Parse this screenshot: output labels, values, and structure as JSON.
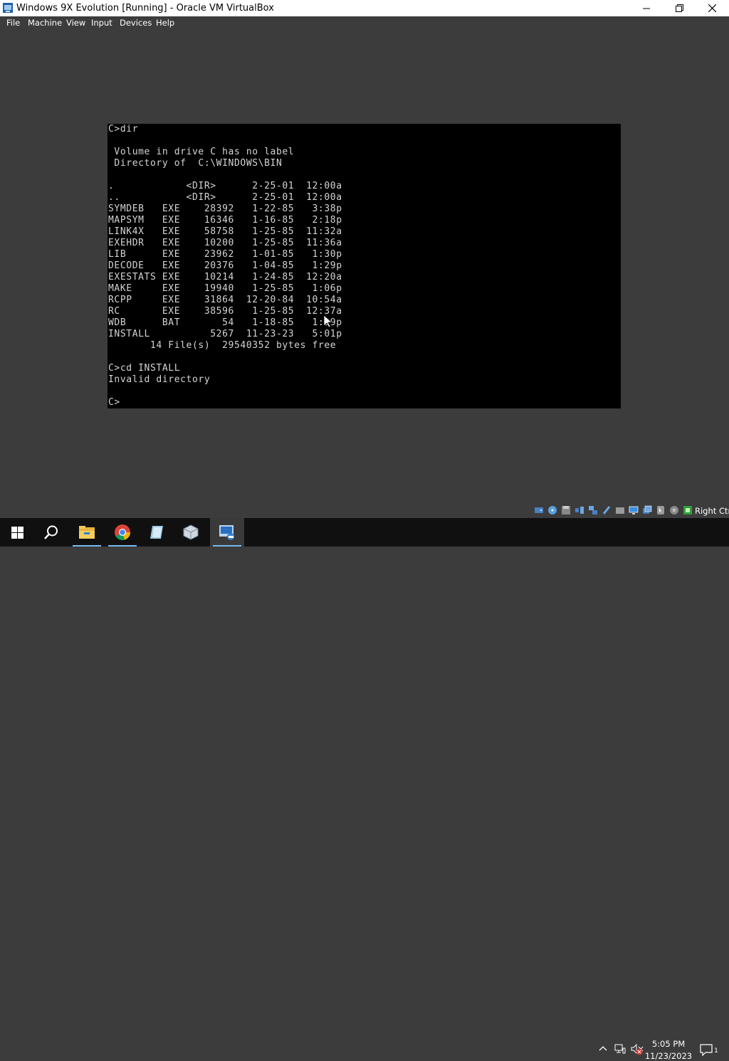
{
  "window": {
    "title": "Windows 9X Evolution [Running] - Oracle VM VirtualBox",
    "minimize_icon": "minimize-icon",
    "maximize_icon": "restore-icon",
    "close_icon": "close-icon"
  },
  "menu": {
    "items": [
      {
        "label": "File"
      },
      {
        "label": "Machine"
      },
      {
        "label": "View"
      },
      {
        "label": "Input"
      },
      {
        "label": "Devices"
      },
      {
        "label": "Help"
      }
    ]
  },
  "console": {
    "lines": [
      "C>dir",
      "",
      " Volume in drive C has no label",
      " Directory of  C:\\WINDOWS\\BIN",
      "",
      ".            <DIR>      2-25-01  12:00a",
      "..           <DIR>      2-25-01  12:00a",
      "SYMDEB   EXE    28392   1-22-85   3:38p",
      "MAPSYM   EXE    16346   1-16-85   2:18p",
      "LINK4X   EXE    58758   1-25-85  11:32a",
      "EXEHDR   EXE    10200   1-25-85  11:36a",
      "LIB      EXE    23962   1-01-85   1:30p",
      "DECODE   EXE    20376   1-04-85   1:29p",
      "EXESTATS EXE    10214   1-24-85  12:20a",
      "MAKE     EXE    19940   1-25-85   1:06p",
      "RCPP     EXE    31864  12-20-84  10:54a",
      "RC       EXE    38596   1-25-85  12:37a",
      "WDB      BAT       54   1-18-85   1:29p",
      "INSTALL          5267  11-23-23   5:01p",
      "       14 File(s)  29540352 bytes free",
      "",
      "C>cd INSTALL",
      "Invalid directory",
      "",
      "C>"
    ]
  },
  "statusbar": {
    "host_key": "Right Ctrl",
    "icons": [
      "hard-disk-icon",
      "optical-drive-icon",
      "floppy-icon",
      "audio-icon",
      "network-icon",
      "usb-icon",
      "shared-folders-icon",
      "display-icon",
      "video-capture-icon",
      "mouse-integration-icon",
      "keyboard-icon",
      "recording-icon",
      "cpu-icon"
    ]
  },
  "taskbar": {
    "time": "5:05 PM",
    "date": "11/23/2023",
    "notification_badge": "1"
  },
  "colors": {
    "console_bg": "#000000",
    "console_text": "#d4d4d4",
    "vm_bg": "#3c3c3c",
    "taskbar_bg": "#101010",
    "accent": "#76b9ed"
  }
}
